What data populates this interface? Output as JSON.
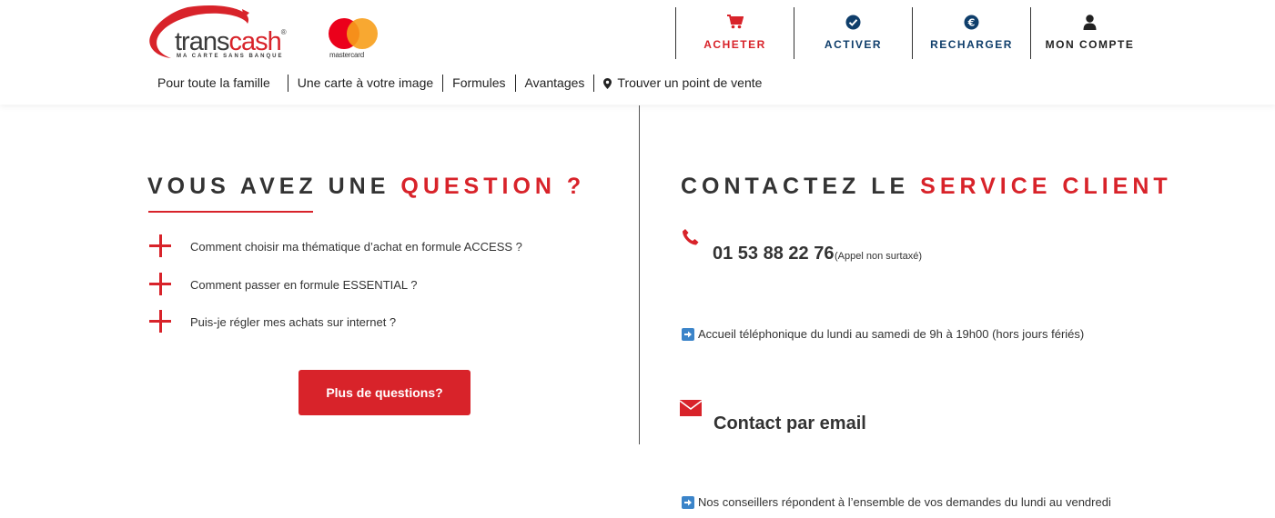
{
  "brand": {
    "logo_text_1": "trans",
    "logo_text_2": "cash",
    "logo_reg": "®",
    "tagline": "MA CARTE SANS BANQUE",
    "partner_text": "mastercard"
  },
  "actions": [
    {
      "label": "ACHETER",
      "icon": "cart-icon",
      "color": "#d8232a"
    },
    {
      "label": "ACTIVER",
      "icon": "check-circle-icon",
      "color": "#0f3e6b"
    },
    {
      "label": "RECHARGER",
      "icon": "euro-circle-icon",
      "color": "#0f3e6b"
    },
    {
      "label": "MON COMPTE",
      "icon": "user-icon",
      "color": "#222222"
    }
  ],
  "nav": [
    {
      "label": "Pour toute la famille"
    },
    {
      "label": "Une carte à votre image"
    },
    {
      "label": "Formules"
    },
    {
      "label": "Avantages"
    },
    {
      "label": "Trouver un point de vente",
      "icon": "map-pin-icon"
    }
  ],
  "faq_section": {
    "title_plain": "VOUS AVEZ UNE ",
    "title_highlight": "QUESTION ?",
    "questions": [
      "Comment choisir ma thématique d’achat en formule ACCESS ?",
      "Comment passer en formule ESSENTIAL ?",
      "Puis-je régler mes achats sur internet ?"
    ],
    "more_button": "Plus de questions?"
  },
  "contact_section": {
    "title_plain": "CONTACTEZ LE ",
    "title_highlight": "SERVICE CLIENT",
    "phone_number": "01 53 88 22 76",
    "phone_note": "(Appel non surtaxé)",
    "phone_hours": "Accueil téléphonique du lundi au samedi de 9h à 19h00 (hors jours fériés)",
    "email_heading": "Contact par email",
    "email_info": "Nos conseillers répondent à l’ensemble de vos demandes du lundi au vendredi"
  },
  "colors": {
    "accent": "#d8232a",
    "navy": "#0f3e6b",
    "text": "#333333"
  }
}
